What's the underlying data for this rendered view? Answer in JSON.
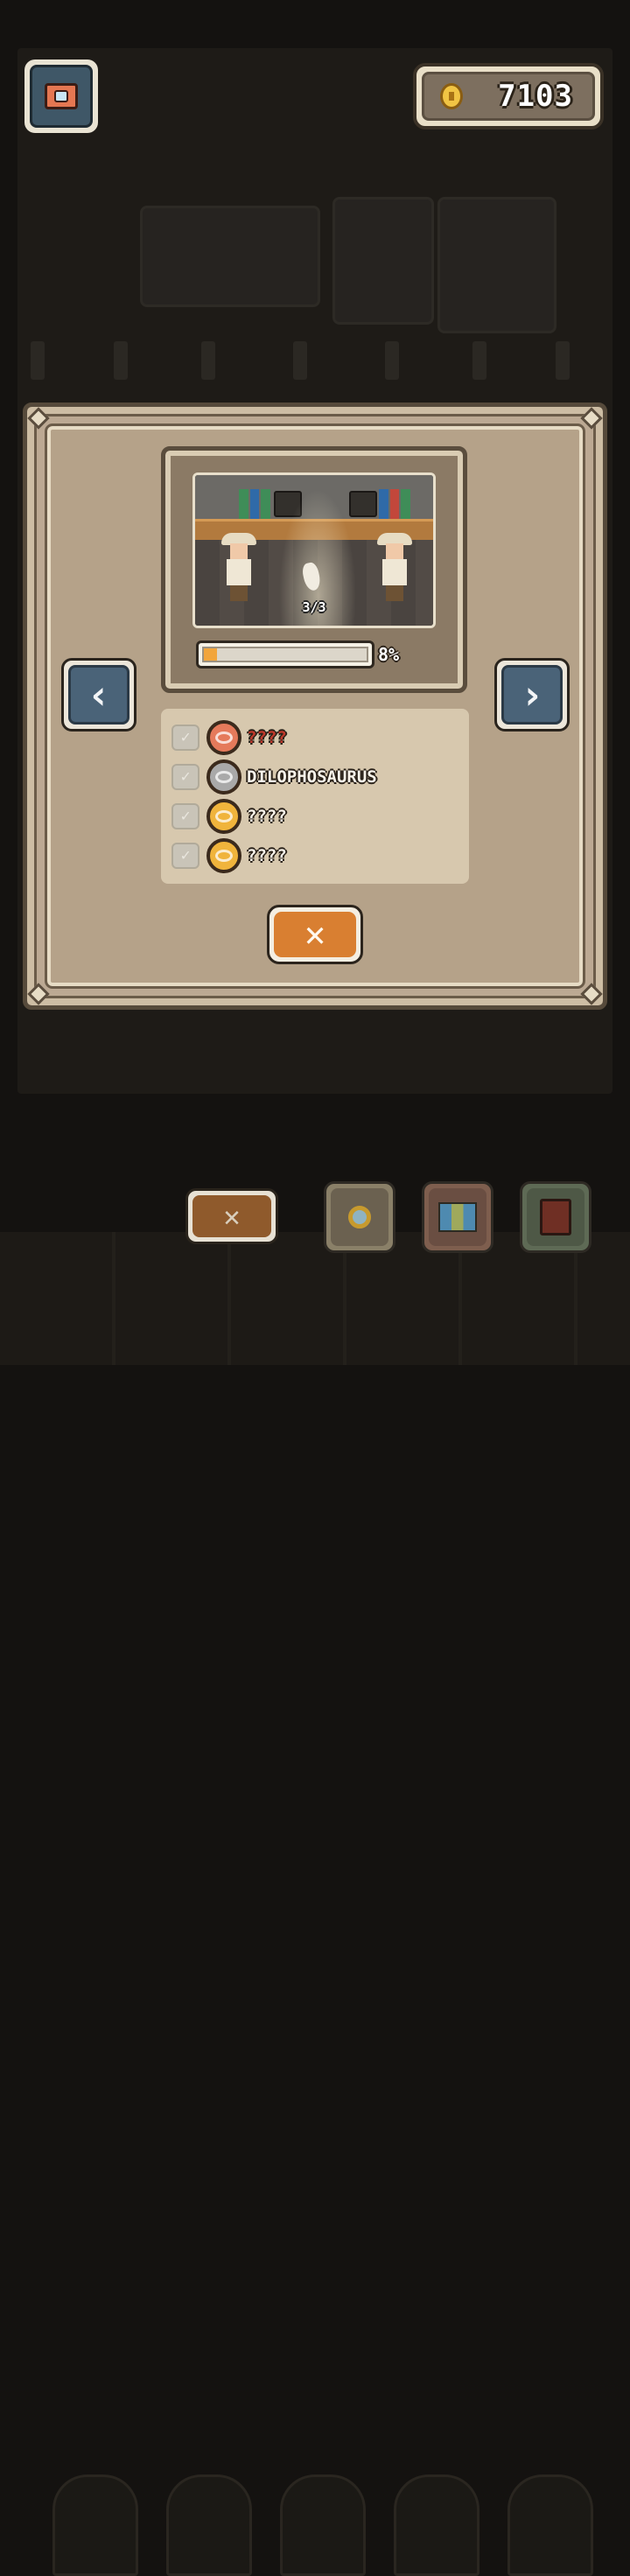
{
  "hud": {
    "camera_icon": "camera-icon",
    "coin_icon": "coin-icon",
    "coins": "7103"
  },
  "preview": {
    "scene_count": "3/3",
    "progress_label": "8%",
    "progress_fraction": 0.08
  },
  "species": [
    {
      "name": "????",
      "badge_color": "#e57a5b",
      "name_color": "#c0392b"
    },
    {
      "name": "DILOPHOSAURUS",
      "badge_color": "#a9a9a9",
      "name_color": "#f8f3ea"
    },
    {
      "name": "????",
      "badge_color": "#f0b43c",
      "name_color": "#f8f3ea"
    },
    {
      "name": "????",
      "badge_color": "#f0b43c",
      "name_color": "#f8f3ea"
    }
  ],
  "buttons": {
    "prev_glyph": "‹",
    "next_glyph": "›",
    "close_glyph": "✕",
    "bottom_close_glyph": "✕"
  },
  "colors": {
    "accent_orange": "#d97f31",
    "panel_bg": "#b5a289",
    "arrow_blue": "#4a6378"
  }
}
